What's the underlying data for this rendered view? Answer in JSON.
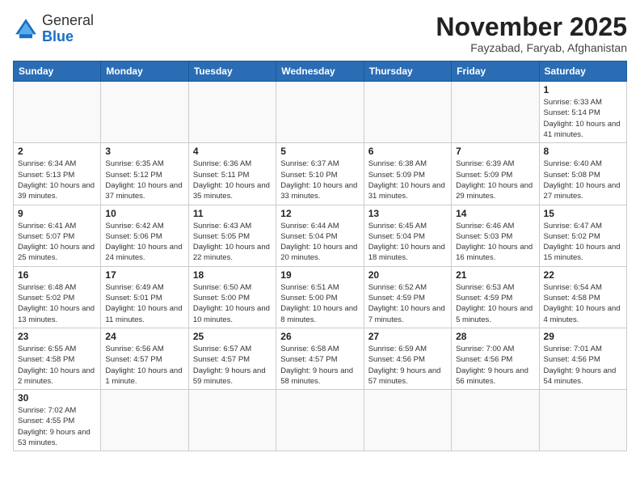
{
  "logo": {
    "text_general": "General",
    "text_blue": "Blue"
  },
  "header": {
    "title": "November 2025",
    "subtitle": "Fayzabad, Faryab, Afghanistan"
  },
  "weekdays": [
    "Sunday",
    "Monday",
    "Tuesday",
    "Wednesday",
    "Thursday",
    "Friday",
    "Saturday"
  ],
  "weeks": [
    [
      {
        "day": "",
        "info": ""
      },
      {
        "day": "",
        "info": ""
      },
      {
        "day": "",
        "info": ""
      },
      {
        "day": "",
        "info": ""
      },
      {
        "day": "",
        "info": ""
      },
      {
        "day": "",
        "info": ""
      },
      {
        "day": "1",
        "info": "Sunrise: 6:33 AM\nSunset: 5:14 PM\nDaylight: 10 hours and 41 minutes."
      }
    ],
    [
      {
        "day": "2",
        "info": "Sunrise: 6:34 AM\nSunset: 5:13 PM\nDaylight: 10 hours and 39 minutes."
      },
      {
        "day": "3",
        "info": "Sunrise: 6:35 AM\nSunset: 5:12 PM\nDaylight: 10 hours and 37 minutes."
      },
      {
        "day": "4",
        "info": "Sunrise: 6:36 AM\nSunset: 5:11 PM\nDaylight: 10 hours and 35 minutes."
      },
      {
        "day": "5",
        "info": "Sunrise: 6:37 AM\nSunset: 5:10 PM\nDaylight: 10 hours and 33 minutes."
      },
      {
        "day": "6",
        "info": "Sunrise: 6:38 AM\nSunset: 5:09 PM\nDaylight: 10 hours and 31 minutes."
      },
      {
        "day": "7",
        "info": "Sunrise: 6:39 AM\nSunset: 5:09 PM\nDaylight: 10 hours and 29 minutes."
      },
      {
        "day": "8",
        "info": "Sunrise: 6:40 AM\nSunset: 5:08 PM\nDaylight: 10 hours and 27 minutes."
      }
    ],
    [
      {
        "day": "9",
        "info": "Sunrise: 6:41 AM\nSunset: 5:07 PM\nDaylight: 10 hours and 25 minutes."
      },
      {
        "day": "10",
        "info": "Sunrise: 6:42 AM\nSunset: 5:06 PM\nDaylight: 10 hours and 24 minutes."
      },
      {
        "day": "11",
        "info": "Sunrise: 6:43 AM\nSunset: 5:05 PM\nDaylight: 10 hours and 22 minutes."
      },
      {
        "day": "12",
        "info": "Sunrise: 6:44 AM\nSunset: 5:04 PM\nDaylight: 10 hours and 20 minutes."
      },
      {
        "day": "13",
        "info": "Sunrise: 6:45 AM\nSunset: 5:04 PM\nDaylight: 10 hours and 18 minutes."
      },
      {
        "day": "14",
        "info": "Sunrise: 6:46 AM\nSunset: 5:03 PM\nDaylight: 10 hours and 16 minutes."
      },
      {
        "day": "15",
        "info": "Sunrise: 6:47 AM\nSunset: 5:02 PM\nDaylight: 10 hours and 15 minutes."
      }
    ],
    [
      {
        "day": "16",
        "info": "Sunrise: 6:48 AM\nSunset: 5:02 PM\nDaylight: 10 hours and 13 minutes."
      },
      {
        "day": "17",
        "info": "Sunrise: 6:49 AM\nSunset: 5:01 PM\nDaylight: 10 hours and 11 minutes."
      },
      {
        "day": "18",
        "info": "Sunrise: 6:50 AM\nSunset: 5:00 PM\nDaylight: 10 hours and 10 minutes."
      },
      {
        "day": "19",
        "info": "Sunrise: 6:51 AM\nSunset: 5:00 PM\nDaylight: 10 hours and 8 minutes."
      },
      {
        "day": "20",
        "info": "Sunrise: 6:52 AM\nSunset: 4:59 PM\nDaylight: 10 hours and 7 minutes."
      },
      {
        "day": "21",
        "info": "Sunrise: 6:53 AM\nSunset: 4:59 PM\nDaylight: 10 hours and 5 minutes."
      },
      {
        "day": "22",
        "info": "Sunrise: 6:54 AM\nSunset: 4:58 PM\nDaylight: 10 hours and 4 minutes."
      }
    ],
    [
      {
        "day": "23",
        "info": "Sunrise: 6:55 AM\nSunset: 4:58 PM\nDaylight: 10 hours and 2 minutes."
      },
      {
        "day": "24",
        "info": "Sunrise: 6:56 AM\nSunset: 4:57 PM\nDaylight: 10 hours and 1 minute."
      },
      {
        "day": "25",
        "info": "Sunrise: 6:57 AM\nSunset: 4:57 PM\nDaylight: 9 hours and 59 minutes."
      },
      {
        "day": "26",
        "info": "Sunrise: 6:58 AM\nSunset: 4:57 PM\nDaylight: 9 hours and 58 minutes."
      },
      {
        "day": "27",
        "info": "Sunrise: 6:59 AM\nSunset: 4:56 PM\nDaylight: 9 hours and 57 minutes."
      },
      {
        "day": "28",
        "info": "Sunrise: 7:00 AM\nSunset: 4:56 PM\nDaylight: 9 hours and 56 minutes."
      },
      {
        "day": "29",
        "info": "Sunrise: 7:01 AM\nSunset: 4:56 PM\nDaylight: 9 hours and 54 minutes."
      }
    ],
    [
      {
        "day": "30",
        "info": "Sunrise: 7:02 AM\nSunset: 4:55 PM\nDaylight: 9 hours and 53 minutes."
      },
      {
        "day": "",
        "info": ""
      },
      {
        "day": "",
        "info": ""
      },
      {
        "day": "",
        "info": ""
      },
      {
        "day": "",
        "info": ""
      },
      {
        "day": "",
        "info": ""
      },
      {
        "day": "",
        "info": ""
      }
    ]
  ]
}
